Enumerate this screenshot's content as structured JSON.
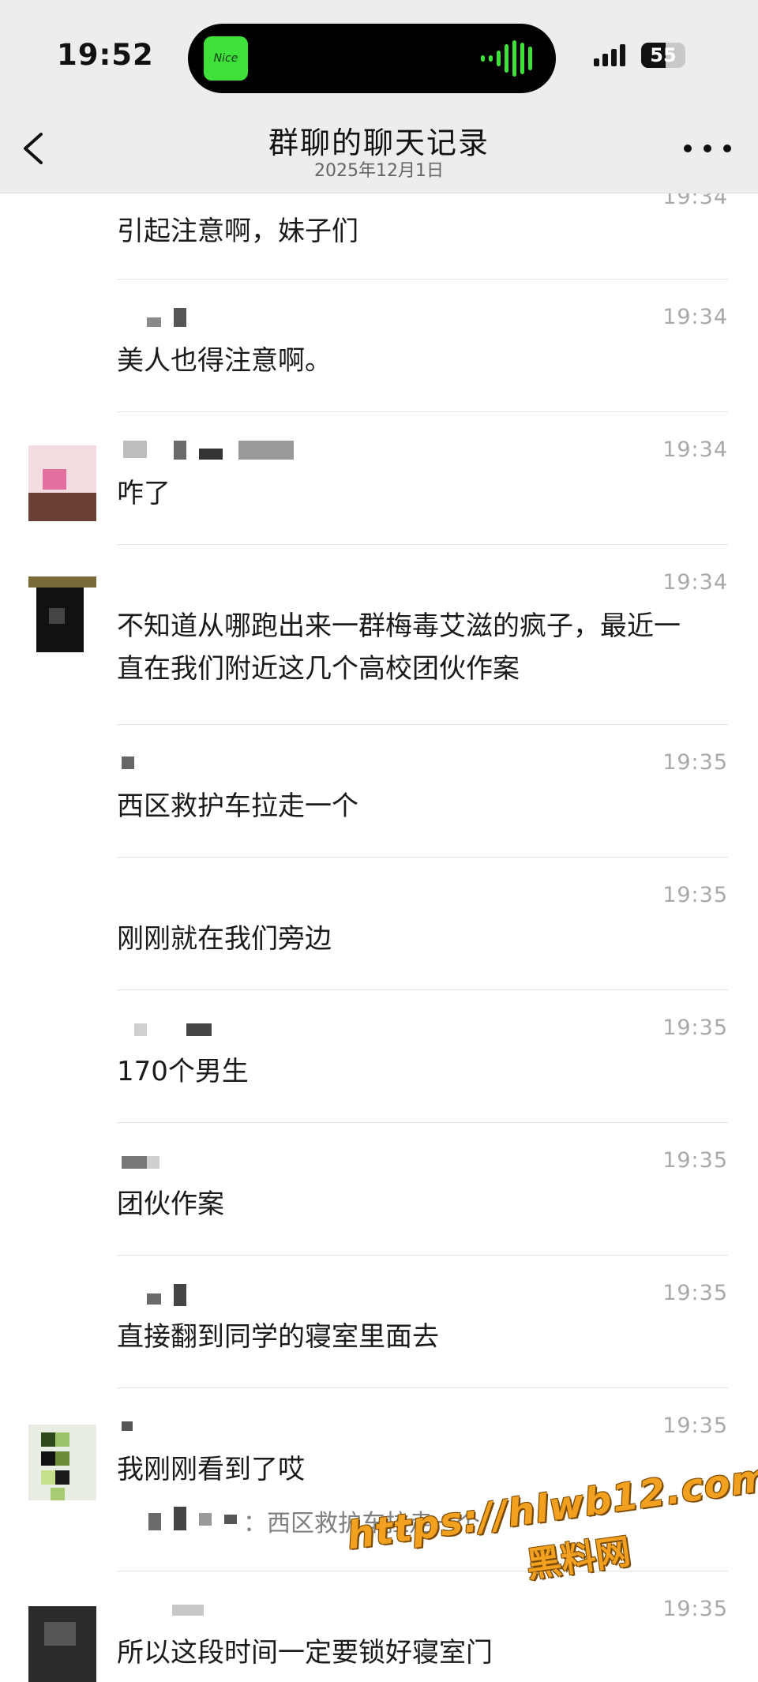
{
  "status_bar": {
    "time": "19:52",
    "island_art_label": "Nice",
    "battery_level": "55"
  },
  "header": {
    "title": "群聊的聊天记录",
    "subtitle": "2025年12月1日"
  },
  "messages": [
    {
      "time": "19:34",
      "text": "引起注意啊，妹子们"
    },
    {
      "time": "19:34",
      "text": "美人也得注意啊。"
    },
    {
      "time": "19:34",
      "text": "咋了"
    },
    {
      "time": "19:34",
      "text": "不知道从哪跑出来一群梅毒艾滋的疯子，最近一直在我们附近这几个高校团伙作案"
    },
    {
      "time": "19:35",
      "text": "西区救护车拉走一个"
    },
    {
      "time": "19:35",
      "text": "刚刚就在我们旁边"
    },
    {
      "time": "19:35",
      "text": "170个男生"
    },
    {
      "time": "19:35",
      "text": "团伙作案"
    },
    {
      "time": "19:35",
      "text": "直接翻到同学的寝室里面去"
    },
    {
      "time": "19:35",
      "text": "我刚刚看到了哎",
      "quote": "：西区救护车拉走一个"
    },
    {
      "time": "19:35",
      "text": "所以这段时间一定要锁好寝室门"
    }
  ],
  "watermark": {
    "url": "https://hlwb12.com",
    "name": "黑料网"
  },
  "colors": {
    "accent_green": "#3fe03a",
    "watermark_orange": "#f2a01f",
    "timestamp_gray": "#a9a9a9"
  }
}
